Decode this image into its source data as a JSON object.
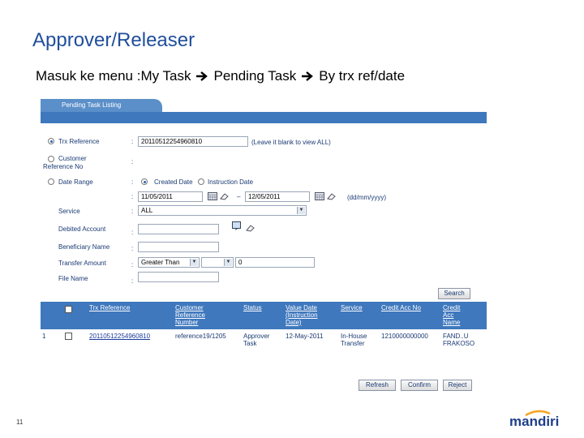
{
  "slide": {
    "title": "Approver/Releaser",
    "subtitle_parts": [
      "Masuk ke menu :My Task",
      "Pending Task",
      "By trx ref/date"
    ],
    "page_number": "11",
    "logo_text": "mandiri",
    "accent_color": "#1f4e9c"
  },
  "screen": {
    "tab_label": "Pending Task Listing",
    "header_color": "#3f78bd",
    "form": {
      "trx_reference_label": "Trx Reference",
      "trx_reference_value": "20110512254960810",
      "trx_reference_hint": "(Leave it blank to view ALL)",
      "customer_reference_label_1": "Customer",
      "customer_reference_label_2": "Reference No",
      "date_range_label": "Date Range",
      "created_date_label": "Created Date",
      "instruction_date_label": "Instruction Date",
      "date_from": "11/05/2011",
      "date_to": "12/05/2011",
      "date_format_hint": "(dd/mm/yyyy)",
      "service_label": "Service",
      "service_value": "ALL",
      "debited_account_label": "Debited Account",
      "beneficiary_name_label": "Beneficiary Name",
      "transfer_amount_label": "Transfer Amount",
      "transfer_operator": "Greater Than",
      "transfer_amount_value": "0",
      "file_name_label": "File Name",
      "search_button": "Search"
    },
    "table": {
      "headers": [
        "Trx Reference",
        "Customer Reference Number",
        "Status",
        "Value Date (Instruction Date)",
        "Service",
        "Credit Acc No",
        "Credit Acc Name"
      ],
      "header_lines": {
        "trx": [
          "Trx Reference"
        ],
        "cust": [
          "Customer",
          "Reference",
          "Number"
        ],
        "status": [
          "Status"
        ],
        "value": [
          "Value Date",
          "(Instruction",
          "Date)"
        ],
        "service": [
          "Service"
        ],
        "credit_no": [
          "Credit Acc No"
        ],
        "credit_name": [
          "Credit",
          "Acc",
          "Name"
        ]
      },
      "row": {
        "index": "1",
        "trx_reference": "20110512254960810",
        "customer_reference": "reference19/1205",
        "status_1": "Approver",
        "status_2": "Task",
        "value_date": "12-May-2011",
        "service_1": "In-House",
        "service_2": "Transfer",
        "credit_acc_no": "1210000000000",
        "credit_name_1": "FAND..U",
        "credit_name_2": "FRAKOSO"
      }
    },
    "actions": {
      "refresh": "Refresh",
      "confirm": "Confirm",
      "reject": "Reject"
    }
  }
}
